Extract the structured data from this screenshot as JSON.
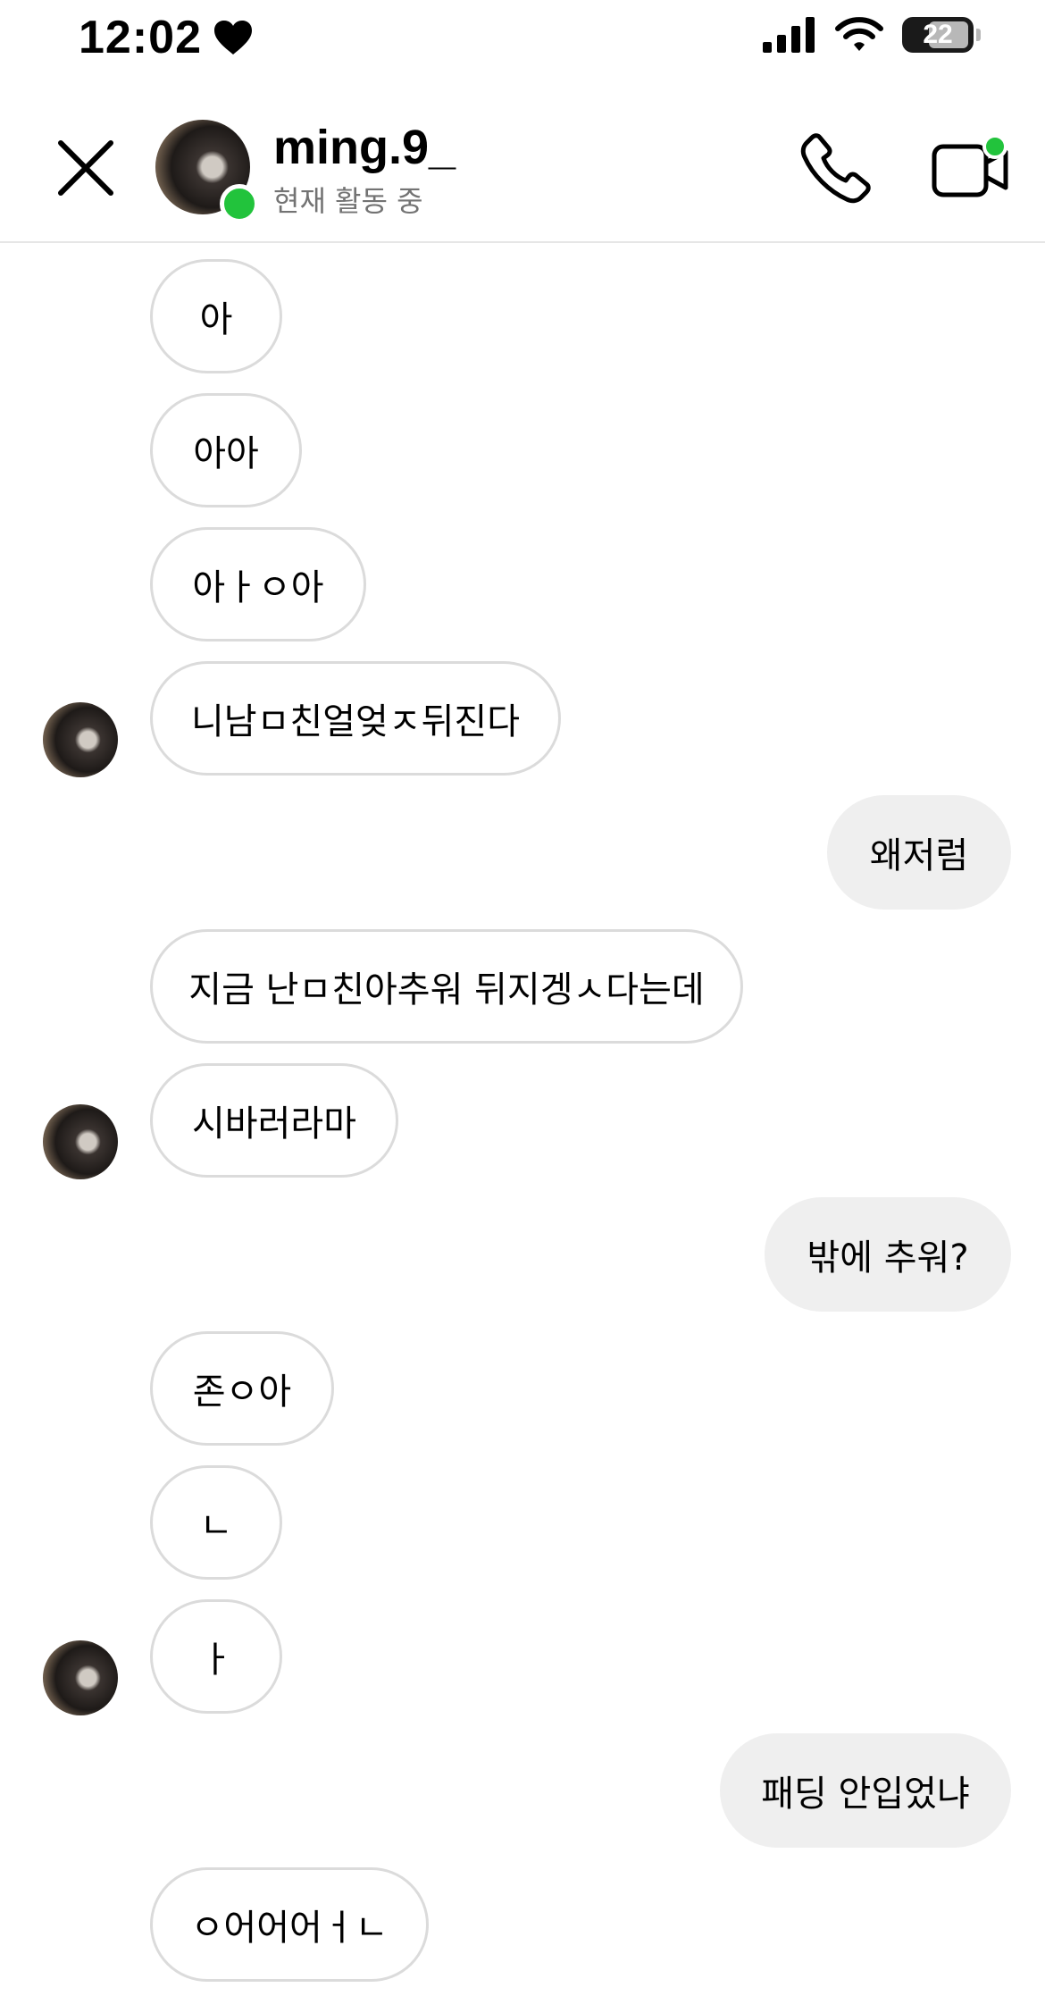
{
  "status_bar": {
    "time": "12:02",
    "battery": "22"
  },
  "header": {
    "username": "ming.9_",
    "activity": "현재 활동 중"
  },
  "messages": [
    {
      "from": "them",
      "text": "아"
    },
    {
      "from": "them",
      "text": "아아"
    },
    {
      "from": "them",
      "text": "아ㅏㅇ아"
    },
    {
      "from": "them",
      "text": "니남ㅁ친얼엊ㅈ뒤진다"
    },
    {
      "from": "me",
      "text": "왜저럼"
    },
    {
      "from": "them",
      "text": "지금 난ㅁ친아추워 뒤지겡ㅅ다는데"
    },
    {
      "from": "them",
      "text": "시바러라마"
    },
    {
      "from": "me",
      "text": "밖에 추워?"
    },
    {
      "from": "them",
      "text": "존ㅇ아"
    },
    {
      "from": "them",
      "text": "ㄴ"
    },
    {
      "from": "them",
      "text": "ㅏ"
    },
    {
      "from": "me",
      "text": "패딩 안입었냐"
    },
    {
      "from": "them",
      "text": "ㅇ어어어ㅓㄴ"
    }
  ]
}
